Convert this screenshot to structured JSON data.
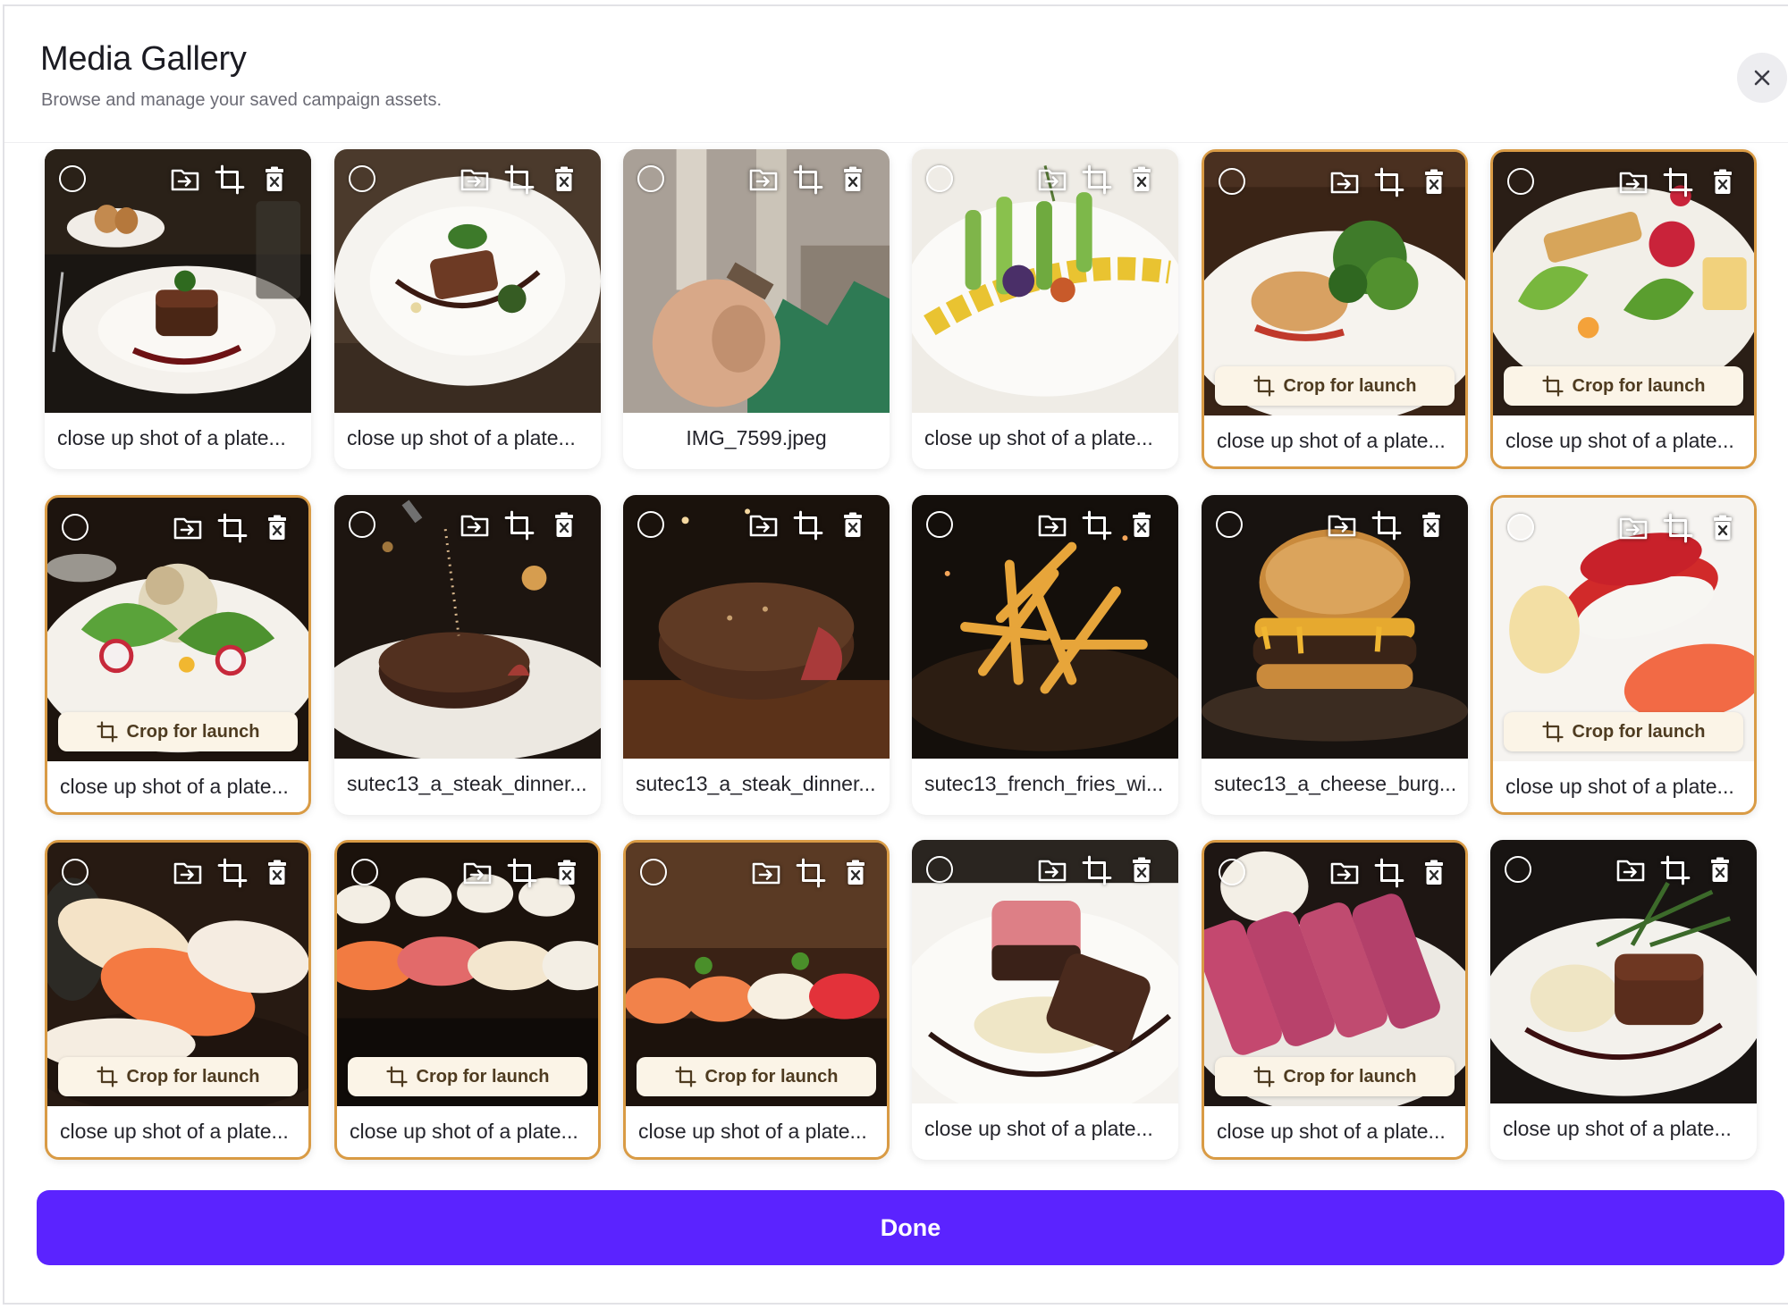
{
  "header": {
    "title": "Media Gallery",
    "subtitle": "Browse and manage your saved campaign assets."
  },
  "close_icon": "close-icon",
  "icons": {
    "select": "select-circle-icon",
    "move": "move-to-folder-icon",
    "crop": "crop-icon",
    "delete": "delete-icon"
  },
  "colors": {
    "accent": "#5b23ff",
    "flag_border": "#d99b45",
    "pill_bg": "#fbf4e7"
  },
  "crop_label": "Crop for launch",
  "items": [
    {
      "caption": "close up shot of a plate...",
      "flagged": false,
      "scene": "steak-plate-dark"
    },
    {
      "caption": "close up shot of a plate...",
      "flagged": false,
      "scene": "steak-plate-light"
    },
    {
      "caption": "IMG_7599.jpeg",
      "flagged": false,
      "scene": "clay-ball"
    },
    {
      "caption": "close up shot of a plate...",
      "flagged": false,
      "scene": "veg-plate"
    },
    {
      "caption": "close up shot of a plate...",
      "flagged": true,
      "scene": "fish-salad"
    },
    {
      "caption": "close up shot of a plate...",
      "flagged": true,
      "scene": "colorful-salad"
    },
    {
      "caption": "close up shot of a plate...",
      "flagged": true,
      "scene": "radish-salad"
    },
    {
      "caption": "sutec13_a_steak_dinner...",
      "flagged": false,
      "scene": "steak-seasoning"
    },
    {
      "caption": "sutec13_a_steak_dinner...",
      "flagged": false,
      "scene": "steak-board"
    },
    {
      "caption": "sutec13_french_fries_wi...",
      "flagged": false,
      "scene": "fries"
    },
    {
      "caption": "sutec13_a_cheese_burg...",
      "flagged": false,
      "scene": "burger"
    },
    {
      "caption": "close up shot of a plate...",
      "flagged": true,
      "scene": "tuna-nigiri"
    },
    {
      "caption": "close up shot of a plate...",
      "flagged": true,
      "scene": "salmon-nigiri"
    },
    {
      "caption": "close up shot of a plate...",
      "flagged": true,
      "scene": "sushi-row"
    },
    {
      "caption": "close up shot of a plate...",
      "flagged": true,
      "scene": "sushi-board"
    },
    {
      "caption": "close up shot of a plate...",
      "flagged": false,
      "scene": "steak-cut"
    },
    {
      "caption": "close up shot of a plate...",
      "flagged": true,
      "scene": "sliced-steak"
    },
    {
      "caption": "close up shot of a plate...",
      "flagged": false,
      "scene": "filet-rosemary"
    }
  ],
  "done_label": "Done"
}
